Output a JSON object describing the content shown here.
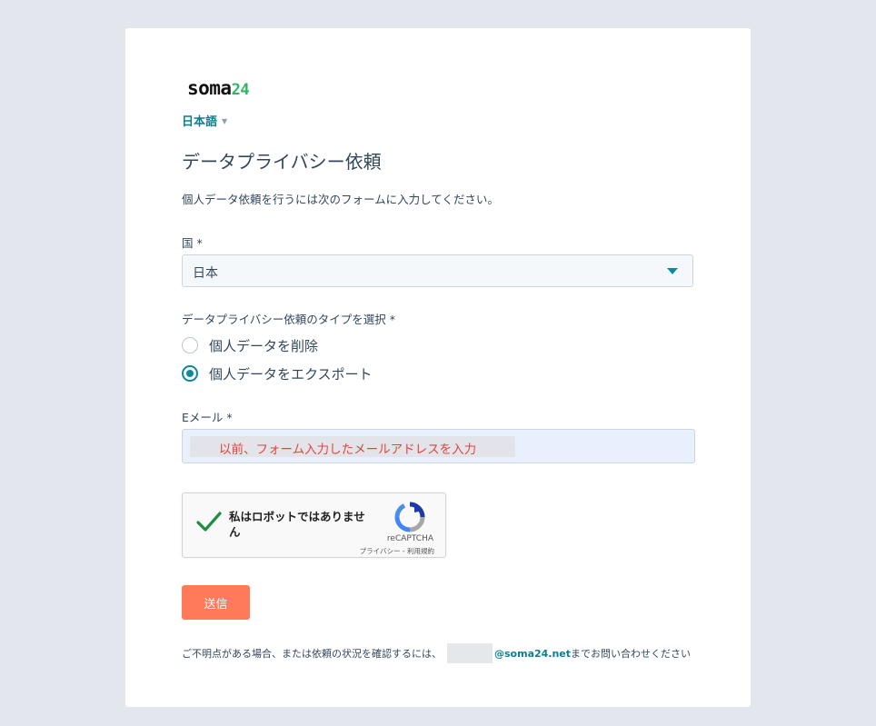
{
  "brand": {
    "logo_text": "soma",
    "logo_number": "24"
  },
  "language": {
    "selected": "日本語",
    "caret": "▼"
  },
  "form": {
    "title": "データプライバシー依頼",
    "description": "個人データ依頼を行うには次のフォームに入力してください。",
    "country": {
      "label": "国 *",
      "value": "日本"
    },
    "request_type": {
      "label": "データプライバシー依頼のタイプを選択 *",
      "options": [
        {
          "label": "個人データを削除",
          "checked": false
        },
        {
          "label": "個人データをエクスポート",
          "checked": true
        }
      ]
    },
    "email": {
      "label": "Eメール *",
      "placeholder": "以前、フォーム入力したメールアドレスを入力",
      "placeholder_color": "#e0463c"
    },
    "captcha": {
      "text": "私はロボットではありません",
      "brand": "reCAPTCHA",
      "terms": "プライバシー - 利用規約"
    },
    "submit_label": "送信",
    "submit_color": "#ff7a59"
  },
  "footer": {
    "prefix": "ご不明点がある場合、または依頼の状況を確認するには、",
    "email_domain": "@soma24.net",
    "suffix": "までお問い合わせください"
  },
  "colors": {
    "accent": "#0b8a9c",
    "background": "#e3e6ec"
  }
}
